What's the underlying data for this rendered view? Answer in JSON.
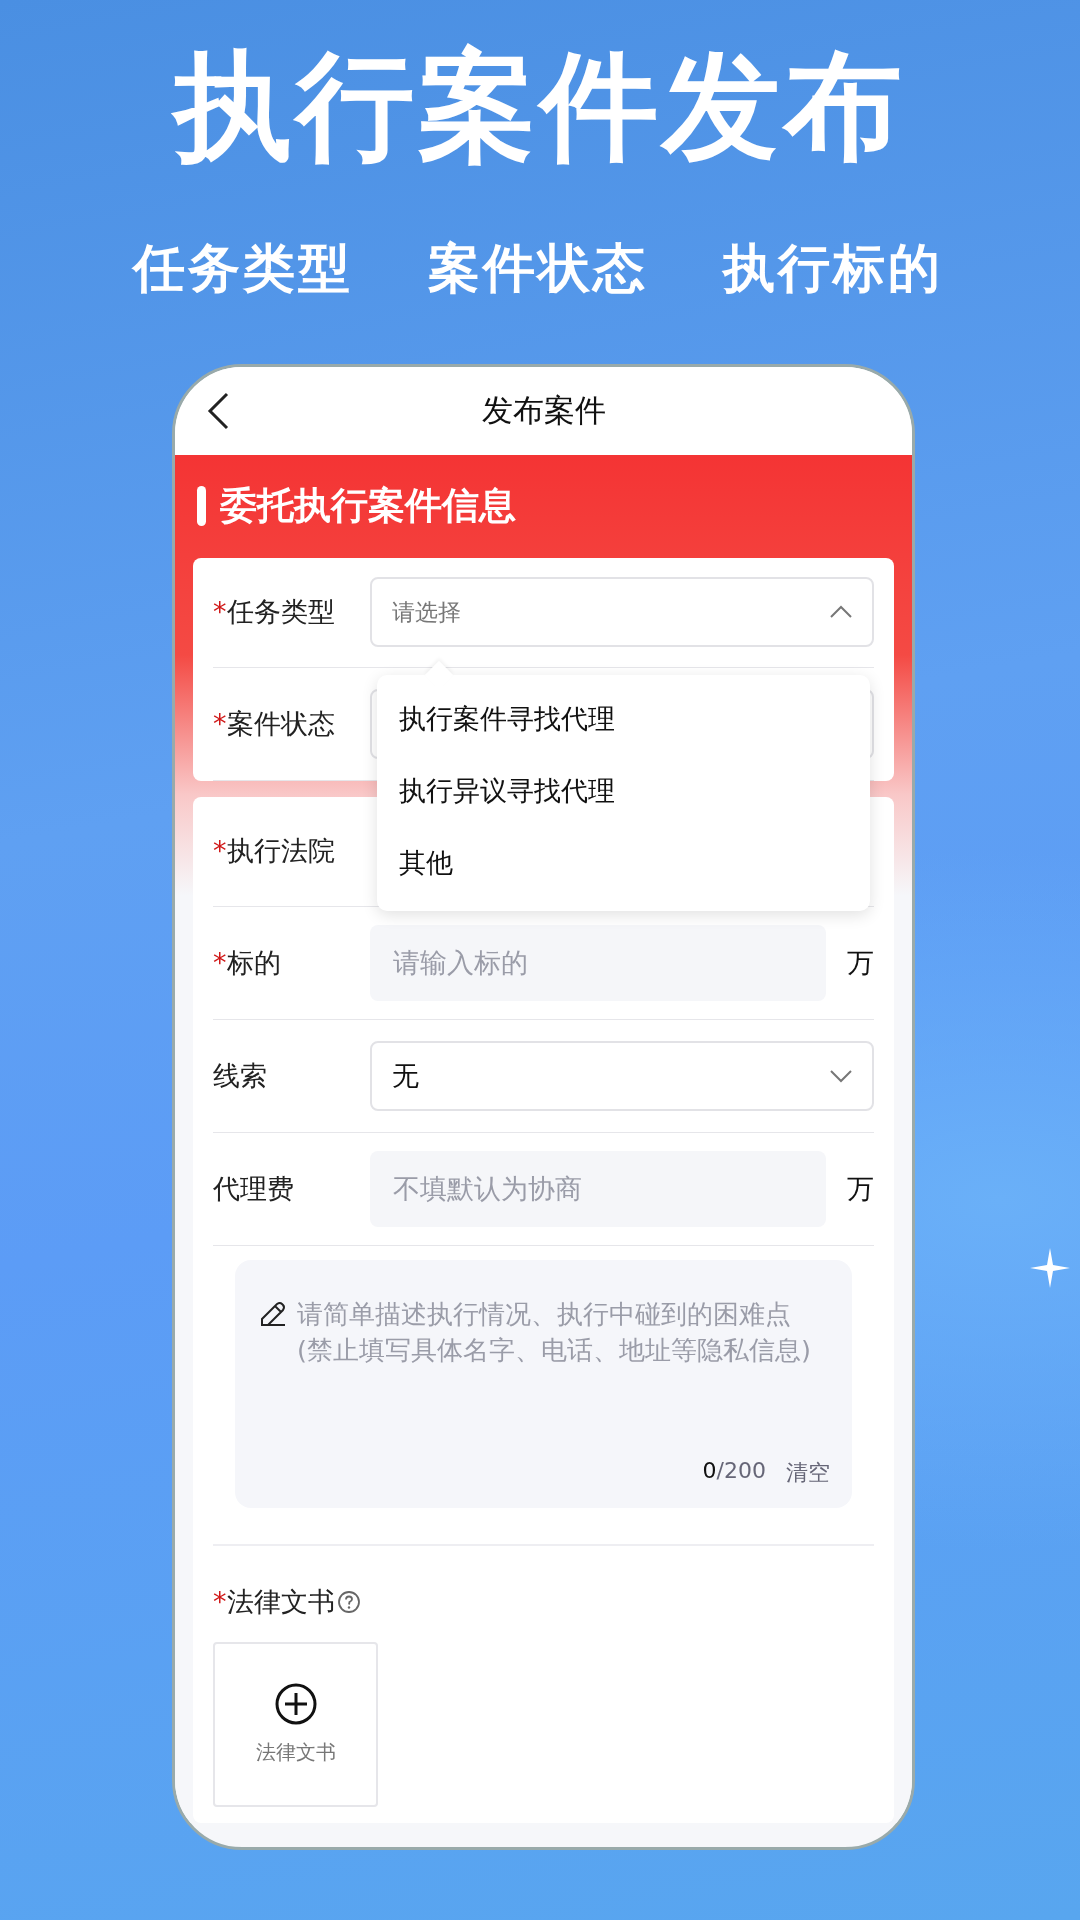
{
  "headline": "执行案件发布",
  "features": [
    "任务类型",
    "案件状态",
    "执行标的"
  ],
  "phone": {
    "nav_title": "发布案件",
    "section_title": "委托执行案件信息",
    "cards": [
      {
        "rows": [
          {
            "kind": "select",
            "mark": "*",
            "label": "任务类型",
            "placeholder": "请选择",
            "expanded": true
          },
          {
            "kind": "select",
            "mark": "*",
            "label": "案件状态"
          }
        ]
      },
      {
        "rows": [
          {
            "kind": "input",
            "mark": "*",
            "label": "执行法院"
          },
          {
            "kind": "input",
            "mark": "*",
            "label": "标的",
            "placeholder": "请输入标的",
            "unit": "万"
          },
          {
            "kind": "select",
            "label": "线索",
            "value": "无",
            "expanded": false
          },
          {
            "kind": "input",
            "label": "代理费",
            "placeholder": "不填默认为协商",
            "unit": "万"
          },
          {
            "kind": "textarea",
            "placeholder": "请简单描述执行情况、执行中碰到的困难点(禁止填写具体名字、电话、地址等隐私信息)",
            "count": "0",
            "max": "/200",
            "clear": "清空"
          },
          {
            "kind": "upload",
            "mark": "*",
            "label": "法律文书",
            "tile_label": "法律文书"
          }
        ]
      }
    ],
    "dropdown": [
      {
        "label": "执行案件寻找代理",
        "selected": false
      },
      {
        "label": "执行异议寻找代理",
        "selected": false
      },
      {
        "label": "其他",
        "selected": false
      }
    ]
  }
}
